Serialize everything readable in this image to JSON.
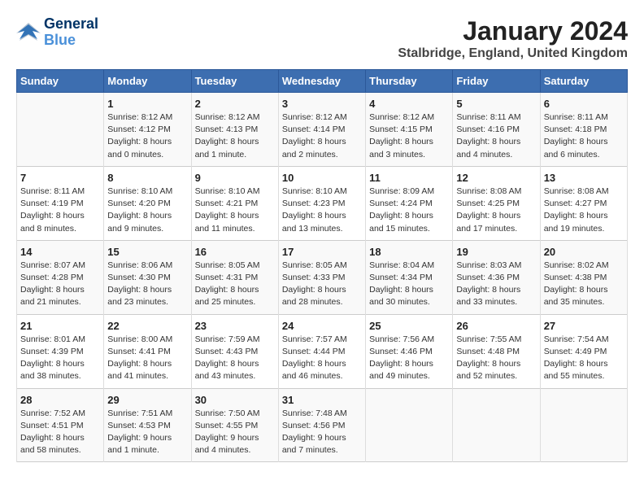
{
  "logo": {
    "line1": "General",
    "line2": "Blue"
  },
  "title": "January 2024",
  "subtitle": "Stalbridge, England, United Kingdom",
  "days_of_week": [
    "Sunday",
    "Monday",
    "Tuesday",
    "Wednesday",
    "Thursday",
    "Friday",
    "Saturday"
  ],
  "weeks": [
    [
      {
        "day": "",
        "info": ""
      },
      {
        "day": "1",
        "info": "Sunrise: 8:12 AM\nSunset: 4:12 PM\nDaylight: 8 hours\nand 0 minutes."
      },
      {
        "day": "2",
        "info": "Sunrise: 8:12 AM\nSunset: 4:13 PM\nDaylight: 8 hours\nand 1 minute."
      },
      {
        "day": "3",
        "info": "Sunrise: 8:12 AM\nSunset: 4:14 PM\nDaylight: 8 hours\nand 2 minutes."
      },
      {
        "day": "4",
        "info": "Sunrise: 8:12 AM\nSunset: 4:15 PM\nDaylight: 8 hours\nand 3 minutes."
      },
      {
        "day": "5",
        "info": "Sunrise: 8:11 AM\nSunset: 4:16 PM\nDaylight: 8 hours\nand 4 minutes."
      },
      {
        "day": "6",
        "info": "Sunrise: 8:11 AM\nSunset: 4:18 PM\nDaylight: 8 hours\nand 6 minutes."
      }
    ],
    [
      {
        "day": "7",
        "info": "Sunrise: 8:11 AM\nSunset: 4:19 PM\nDaylight: 8 hours\nand 8 minutes."
      },
      {
        "day": "8",
        "info": "Sunrise: 8:10 AM\nSunset: 4:20 PM\nDaylight: 8 hours\nand 9 minutes."
      },
      {
        "day": "9",
        "info": "Sunrise: 8:10 AM\nSunset: 4:21 PM\nDaylight: 8 hours\nand 11 minutes."
      },
      {
        "day": "10",
        "info": "Sunrise: 8:10 AM\nSunset: 4:23 PM\nDaylight: 8 hours\nand 13 minutes."
      },
      {
        "day": "11",
        "info": "Sunrise: 8:09 AM\nSunset: 4:24 PM\nDaylight: 8 hours\nand 15 minutes."
      },
      {
        "day": "12",
        "info": "Sunrise: 8:08 AM\nSunset: 4:25 PM\nDaylight: 8 hours\nand 17 minutes."
      },
      {
        "day": "13",
        "info": "Sunrise: 8:08 AM\nSunset: 4:27 PM\nDaylight: 8 hours\nand 19 minutes."
      }
    ],
    [
      {
        "day": "14",
        "info": "Sunrise: 8:07 AM\nSunset: 4:28 PM\nDaylight: 8 hours\nand 21 minutes."
      },
      {
        "day": "15",
        "info": "Sunrise: 8:06 AM\nSunset: 4:30 PM\nDaylight: 8 hours\nand 23 minutes."
      },
      {
        "day": "16",
        "info": "Sunrise: 8:05 AM\nSunset: 4:31 PM\nDaylight: 8 hours\nand 25 minutes."
      },
      {
        "day": "17",
        "info": "Sunrise: 8:05 AM\nSunset: 4:33 PM\nDaylight: 8 hours\nand 28 minutes."
      },
      {
        "day": "18",
        "info": "Sunrise: 8:04 AM\nSunset: 4:34 PM\nDaylight: 8 hours\nand 30 minutes."
      },
      {
        "day": "19",
        "info": "Sunrise: 8:03 AM\nSunset: 4:36 PM\nDaylight: 8 hours\nand 33 minutes."
      },
      {
        "day": "20",
        "info": "Sunrise: 8:02 AM\nSunset: 4:38 PM\nDaylight: 8 hours\nand 35 minutes."
      }
    ],
    [
      {
        "day": "21",
        "info": "Sunrise: 8:01 AM\nSunset: 4:39 PM\nDaylight: 8 hours\nand 38 minutes."
      },
      {
        "day": "22",
        "info": "Sunrise: 8:00 AM\nSunset: 4:41 PM\nDaylight: 8 hours\nand 41 minutes."
      },
      {
        "day": "23",
        "info": "Sunrise: 7:59 AM\nSunset: 4:43 PM\nDaylight: 8 hours\nand 43 minutes."
      },
      {
        "day": "24",
        "info": "Sunrise: 7:57 AM\nSunset: 4:44 PM\nDaylight: 8 hours\nand 46 minutes."
      },
      {
        "day": "25",
        "info": "Sunrise: 7:56 AM\nSunset: 4:46 PM\nDaylight: 8 hours\nand 49 minutes."
      },
      {
        "day": "26",
        "info": "Sunrise: 7:55 AM\nSunset: 4:48 PM\nDaylight: 8 hours\nand 52 minutes."
      },
      {
        "day": "27",
        "info": "Sunrise: 7:54 AM\nSunset: 4:49 PM\nDaylight: 8 hours\nand 55 minutes."
      }
    ],
    [
      {
        "day": "28",
        "info": "Sunrise: 7:52 AM\nSunset: 4:51 PM\nDaylight: 8 hours\nand 58 minutes."
      },
      {
        "day": "29",
        "info": "Sunrise: 7:51 AM\nSunset: 4:53 PM\nDaylight: 9 hours\nand 1 minute."
      },
      {
        "day": "30",
        "info": "Sunrise: 7:50 AM\nSunset: 4:55 PM\nDaylight: 9 hours\nand 4 minutes."
      },
      {
        "day": "31",
        "info": "Sunrise: 7:48 AM\nSunset: 4:56 PM\nDaylight: 9 hours\nand 7 minutes."
      },
      {
        "day": "",
        "info": ""
      },
      {
        "day": "",
        "info": ""
      },
      {
        "day": "",
        "info": ""
      }
    ]
  ]
}
